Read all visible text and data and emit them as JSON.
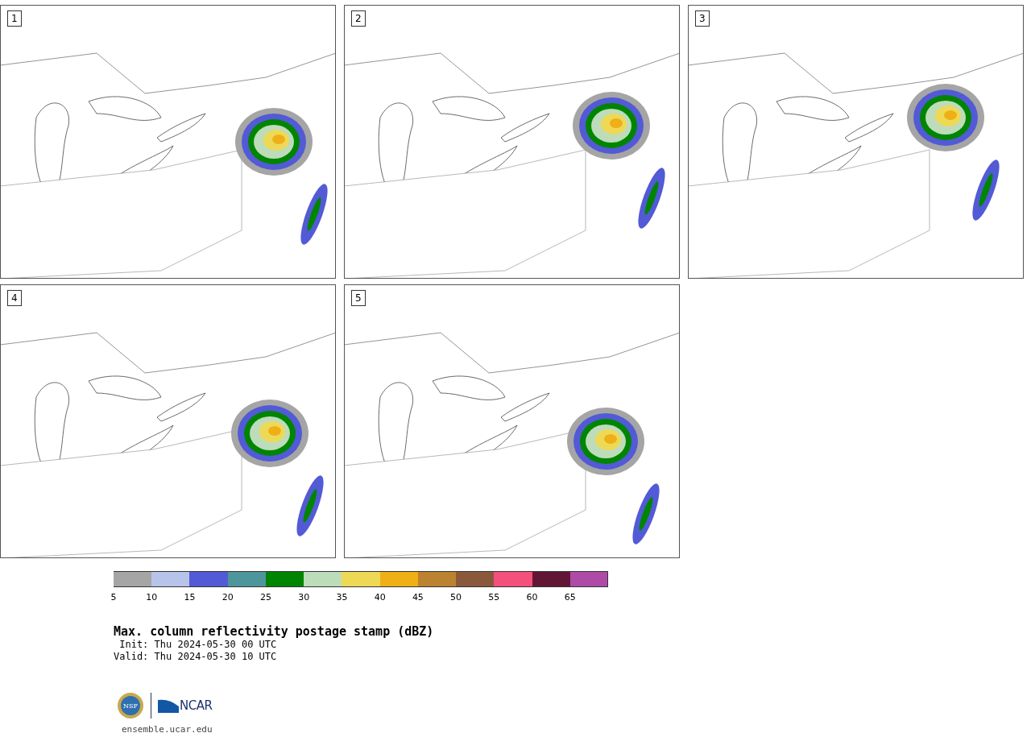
{
  "panels": [
    {
      "label": "1"
    },
    {
      "label": "2"
    },
    {
      "label": "3"
    },
    {
      "label": "4"
    },
    {
      "label": "5"
    }
  ],
  "colorbar": {
    "bins": [
      {
        "tick": "5",
        "color": "#a5a5a5"
      },
      {
        "tick": "10",
        "color": "#b8c3ea"
      },
      {
        "tick": "15",
        "color": "#525ad6"
      },
      {
        "tick": "20",
        "color": "#4e969c"
      },
      {
        "tick": "25",
        "color": "#008500"
      },
      {
        "tick": "30",
        "color": "#bddcba"
      },
      {
        "tick": "35",
        "color": "#eed957"
      },
      {
        "tick": "40",
        "color": "#efaf16"
      },
      {
        "tick": "45",
        "color": "#bb822f"
      },
      {
        "tick": "50",
        "color": "#8a593c"
      },
      {
        "tick": "55",
        "color": "#f4507c"
      },
      {
        "tick": "60",
        "color": "#621636"
      },
      {
        "tick": "65",
        "color": "#ad4ba6"
      }
    ]
  },
  "title": "Max. column reflectivity postage stamp (dBZ)",
  "init": " Init: Thu 2024-05-30 00 UTC",
  "valid": "Valid: Thu 2024-05-30 10 UTC",
  "logos": {
    "nsf": "NSF",
    "ncar": "NCAR"
  },
  "url": "ensemble.ucar.edu"
}
